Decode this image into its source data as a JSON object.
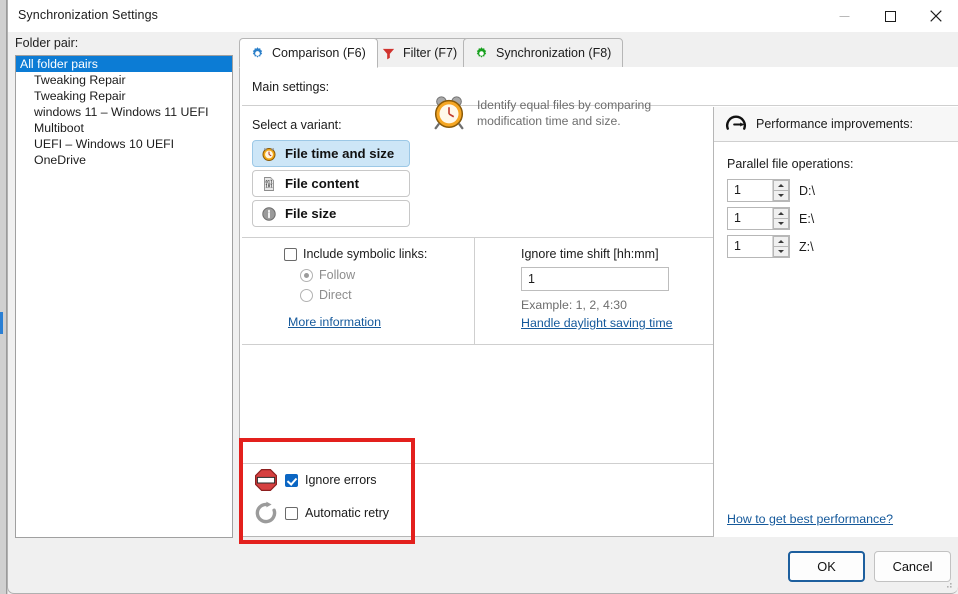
{
  "window": {
    "title": "Synchronization Settings",
    "controls": [
      {
        "name": "minimize",
        "glyph": "minimize-icon"
      },
      {
        "name": "maximize",
        "glyph": "maximize-icon"
      },
      {
        "name": "close",
        "glyph": "close-icon"
      }
    ]
  },
  "folder_pair": {
    "label": "Folder pair:",
    "items": [
      {
        "label": "All folder pairs",
        "selected": true
      },
      {
        "label": "Tweaking Repair",
        "selected": false
      },
      {
        "label": "Tweaking Repair",
        "selected": false
      },
      {
        "label": "windows 11 – Windows 11 UEFI",
        "selected": false
      },
      {
        "label": "Multiboot",
        "selected": false
      },
      {
        "label": "UEFI – Windows 10 UEFI",
        "selected": false
      },
      {
        "label": "OneDrive",
        "selected": false
      }
    ]
  },
  "tabs": [
    {
      "label": "Comparison (F6)",
      "icon": "blue-gear-icon",
      "active": true
    },
    {
      "label": "Filter (F7)",
      "icon": "red-funnel-icon",
      "active": false
    },
    {
      "label": "Synchronization (F8)",
      "icon": "green-gear-icon",
      "active": false
    }
  ],
  "main": {
    "section_title": "Main settings:",
    "select_variant_label": "Select a variant:",
    "variants": [
      {
        "label": "File time and size",
        "icon": "orange-clock-icon",
        "selected": true
      },
      {
        "label": "File content",
        "icon": "binary-file-icon",
        "selected": false
      },
      {
        "label": "File size",
        "icon": "gray-size-icon",
        "selected": false
      }
    ],
    "variant_hint": "Identify equal files by comparing modification time and size.",
    "variant_hint_icon": "alarm-clock-icon",
    "symbolic": {
      "checkbox_label": "Include symbolic links:",
      "checked": false,
      "options": [
        {
          "label": "Follow",
          "selected": true
        },
        {
          "label": "Direct",
          "selected": false
        }
      ],
      "link": "More information"
    },
    "time_shift": {
      "title": "Ignore time shift [hh:mm]",
      "value": "1",
      "placeholder": "",
      "example": "Example:  1, 2, 4:30",
      "link": "Handle daylight saving time"
    },
    "errors": [
      {
        "label": "Ignore errors",
        "checked": true,
        "icon": "stop-sign-icon"
      },
      {
        "label": "Automatic retry",
        "checked": false,
        "icon": "retry-arrow-icon"
      }
    ],
    "highlight_color": "#e3201d"
  },
  "performance": {
    "title": "Performance improvements:",
    "icon": "speedometer-icon",
    "parallel_label": "Parallel file operations:",
    "rows": [
      {
        "value": "1",
        "drive": "D:\\"
      },
      {
        "value": "1",
        "drive": "E:\\"
      },
      {
        "value": "1",
        "drive": "Z:\\"
      }
    ],
    "link": "How to get best performance?"
  },
  "footer": {
    "ok": "OK",
    "cancel": "Cancel"
  },
  "colors": {
    "selection_blue": "#0c7cd5",
    "variant_selected_bg": "#cde6f7",
    "link_blue": "#15599b",
    "annotation_red": "#e3201d",
    "checkbox_blue": "#0b66c3"
  }
}
